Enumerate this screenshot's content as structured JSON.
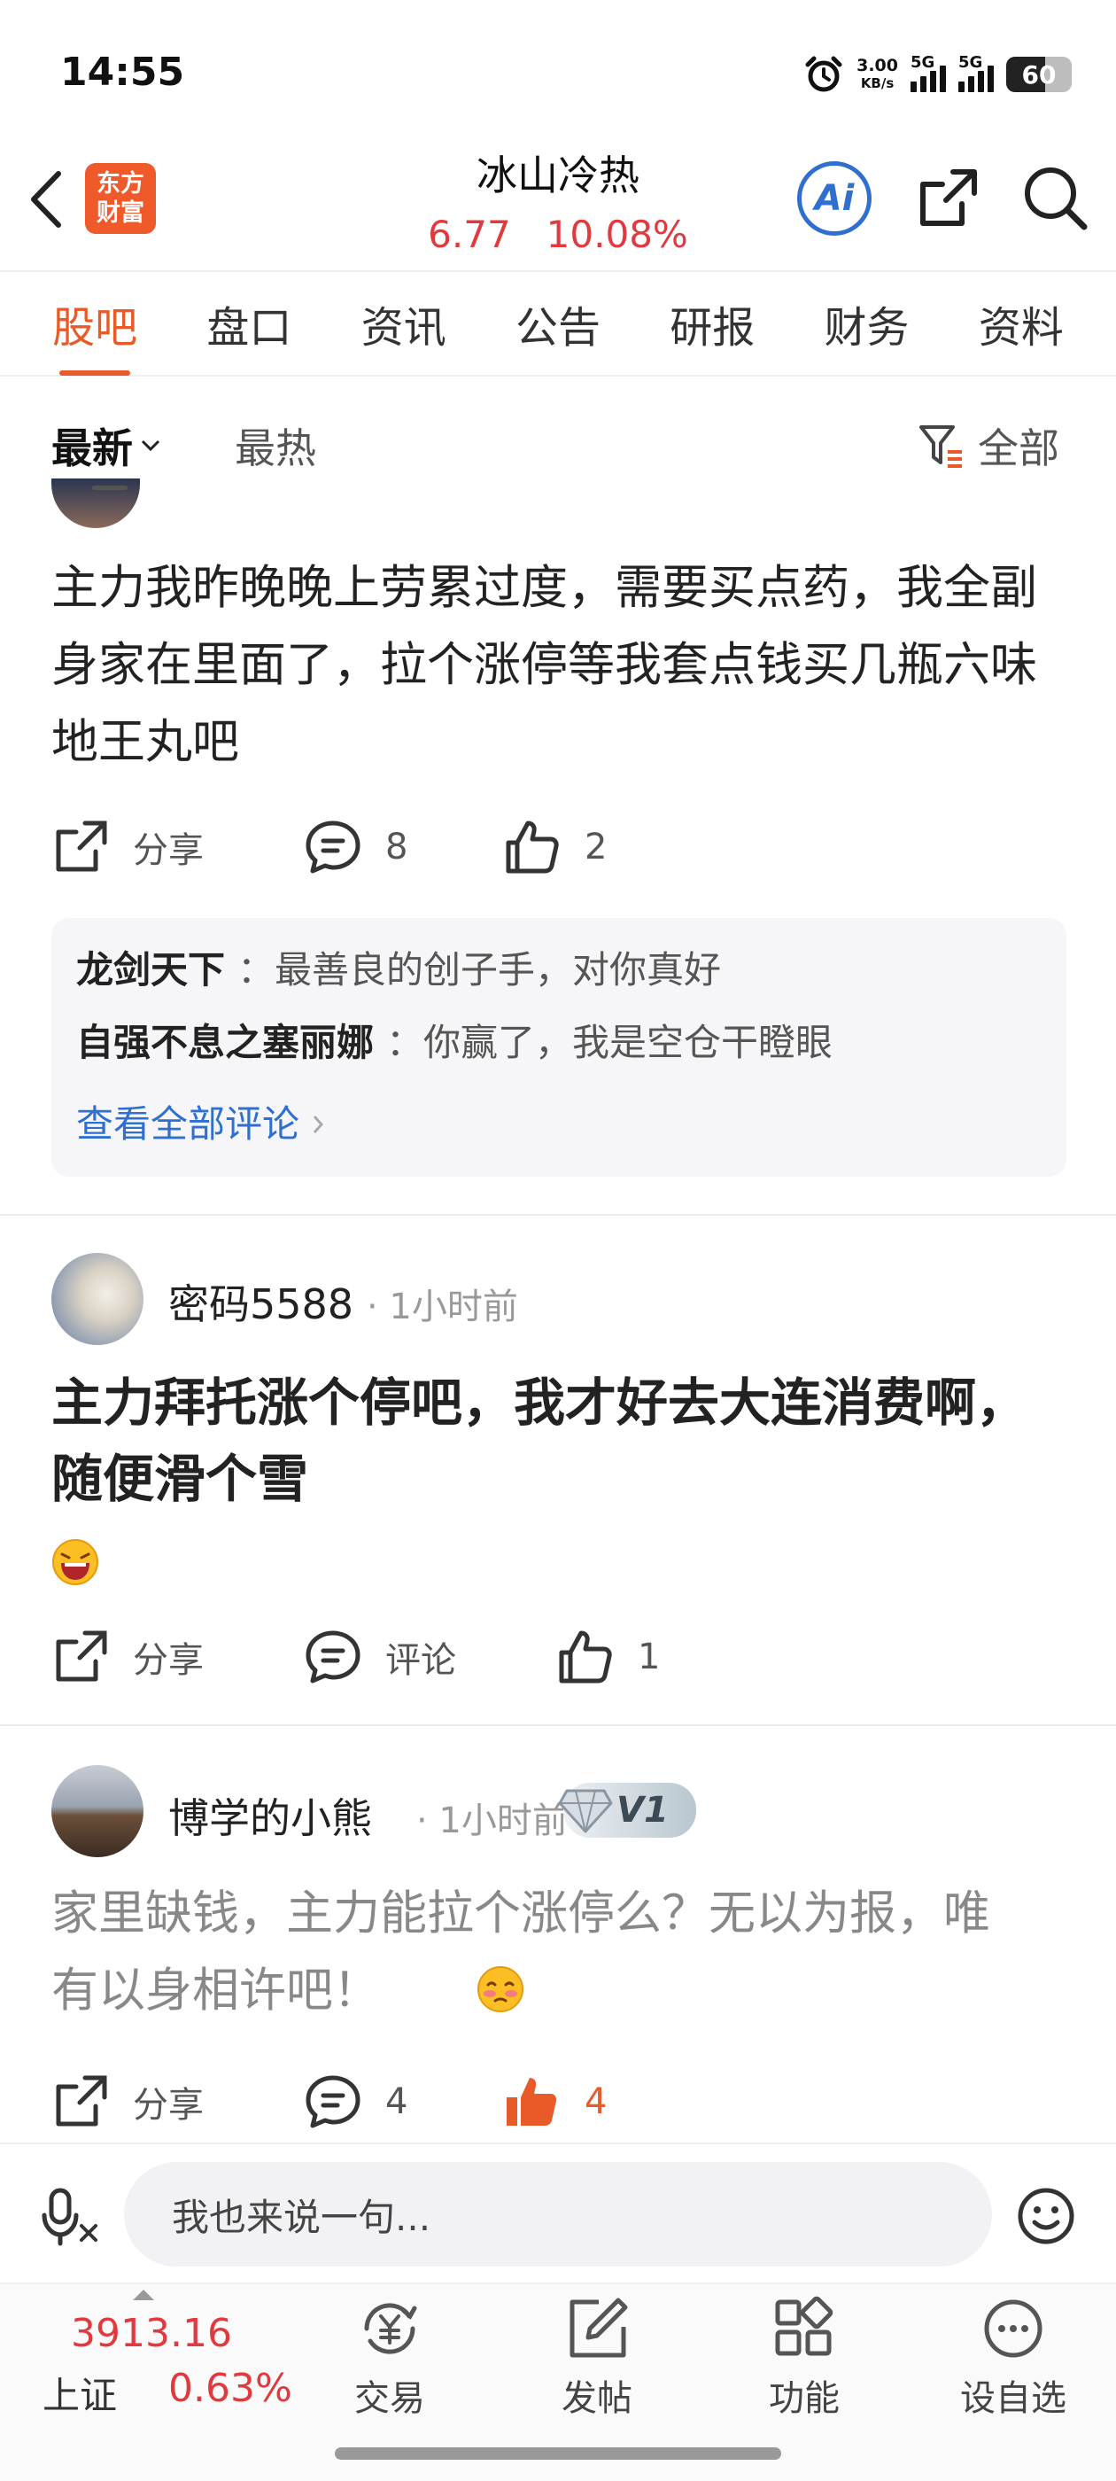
{
  "status": {
    "time": "14:55",
    "net_speed_value": "3.00",
    "net_speed_unit": "KB/s",
    "net1": "5G",
    "net2": "5G",
    "battery": "60"
  },
  "header": {
    "logo_line1": "东方",
    "logo_line2": "财富",
    "title": "冰山冷热",
    "price": "6.77",
    "change": "10.08%",
    "ai_label": "Ai"
  },
  "tabs": [
    "股吧",
    "盘口",
    "资讯",
    "公告",
    "研报",
    "财务",
    "资料"
  ],
  "sort": {
    "latest": "最新",
    "hot": "最热",
    "filter": "全部"
  },
  "posts": [
    {
      "text": "主力我昨晚晚上劳累过度，需要买点药，我全副身家在里面了，拉个涨停等我套点钱买几瓶六味地王丸吧",
      "share": "分享",
      "comments": "8",
      "likes": "2",
      "replies": [
        {
          "user": "龙剑天下",
          "text": "：最善良的创子手，对你真好"
        },
        {
          "user": "自强不息之塞丽娜",
          "text": "：你赢了，我是空仓干瞪眼"
        }
      ],
      "view_all": "查看全部评论"
    },
    {
      "user": "密码5588",
      "time": "· 1小时前",
      "text": "主力拜托涨个停吧，我才好去大连消费啊，随便滑个雪",
      "share": "分享",
      "comments": "评论",
      "likes": "1"
    },
    {
      "user": "博学的小熊",
      "time": "· 1小时前",
      "badge": "V1",
      "text": "家里缺钱，主力能拉个涨停么？无以为报，唯有以身相许吧！",
      "share": "分享",
      "comments": "4",
      "likes": "4"
    }
  ],
  "input": {
    "placeholder": "我也来说一句..."
  },
  "bottom": {
    "index_value": "3913.16",
    "index_name": "上证",
    "index_change": "0.63%",
    "trade": "交易",
    "post": "发帖",
    "functions": "功能",
    "watchlist": "设自选"
  },
  "colors": {
    "accent": "#e85a28",
    "price_red": "#e0393e",
    "link_blue": "#2f6fd0"
  }
}
